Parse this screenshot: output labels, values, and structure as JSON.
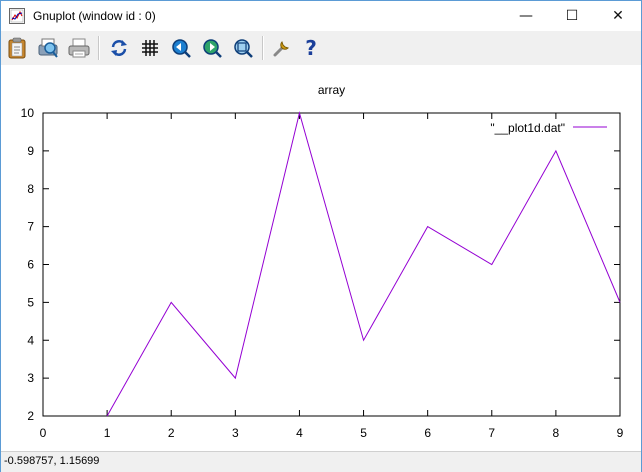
{
  "window": {
    "title": "Gnuplot (window id : 0)",
    "minimize_glyph": "—",
    "maximize_glyph": "☐",
    "close_glyph": "✕"
  },
  "toolbar": {
    "icons": [
      "clipboard-icon",
      "print-preview-icon",
      "printer-icon",
      "replot-icon",
      "grid-icon",
      "zoom-previous-icon",
      "zoom-next-icon",
      "unzoom-icon",
      "options-icon",
      "help-icon"
    ]
  },
  "status": {
    "text": "-0.598757,  1.15699"
  },
  "chart_data": {
    "type": "line",
    "title": "array",
    "xlabel": "",
    "ylabel": "",
    "xlim": [
      0,
      9
    ],
    "ylim": [
      2,
      10
    ],
    "xticks": [
      "0",
      "1",
      "2",
      "3",
      "4",
      "5",
      "6",
      "7",
      "8",
      "9"
    ],
    "yticks": [
      "2",
      "3",
      "4",
      "5",
      "6",
      "7",
      "8",
      "9",
      "10"
    ],
    "grid": false,
    "legend_position": "top-right",
    "series": [
      {
        "name": "\"__plot1d.dat\"",
        "color": "#9400d3",
        "x": [
          1,
          2,
          3,
          4,
          5,
          6,
          7,
          8,
          9
        ],
        "y": [
          2,
          5,
          3,
          10,
          4,
          7,
          6,
          9,
          5
        ]
      }
    ]
  }
}
